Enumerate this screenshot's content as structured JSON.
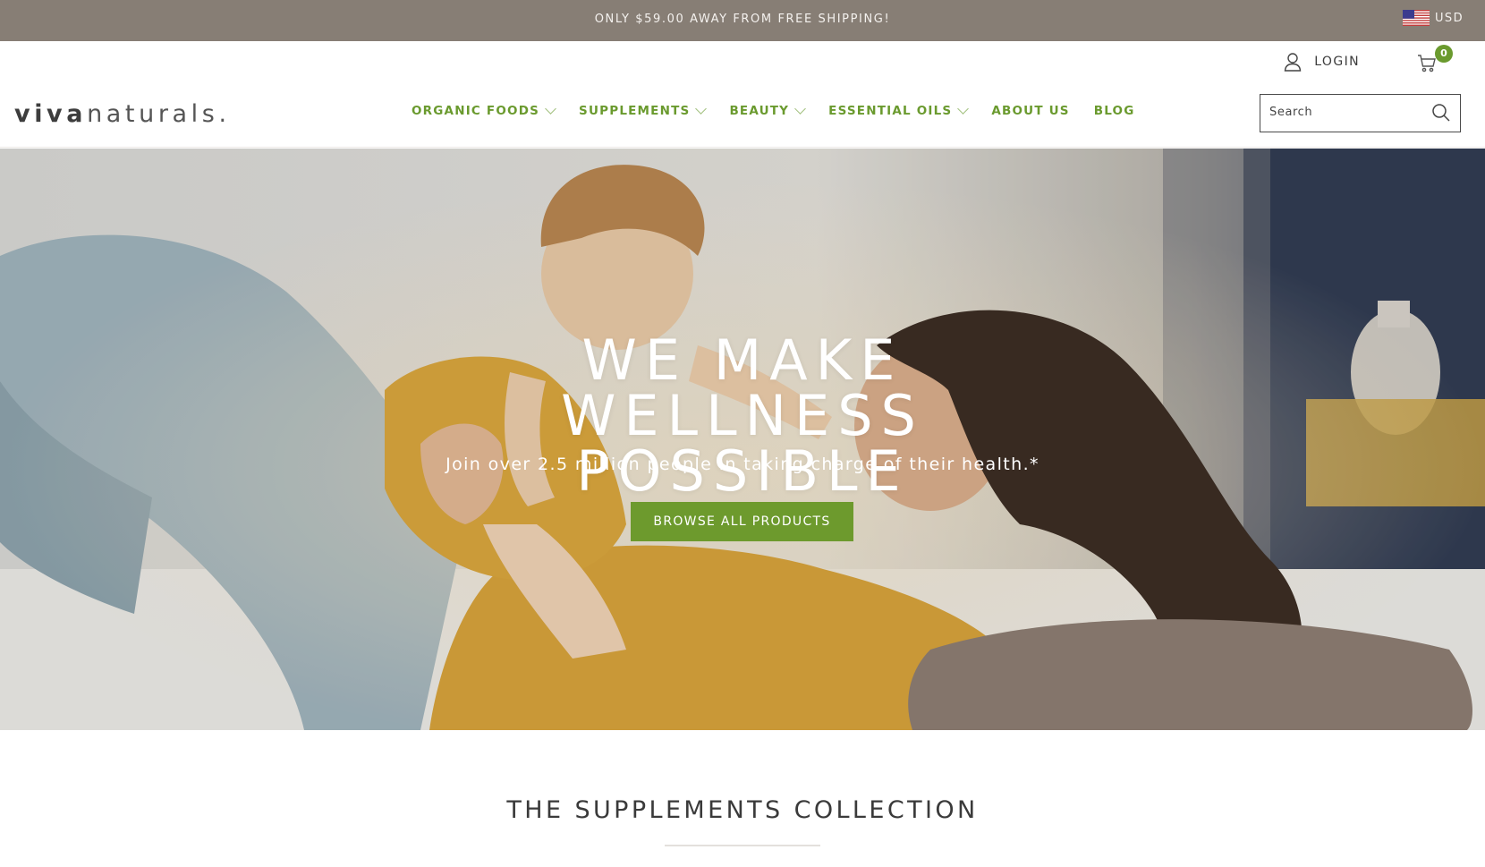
{
  "announcement": {
    "text": "ONLY $59.00 AWAY FROM FREE SHIPPING!"
  },
  "currency": {
    "label": "USD",
    "flag_icon": "us-flag-icon"
  },
  "header": {
    "logo": {
      "bold": "viva",
      "light": "naturals."
    },
    "login_label": "LOGIN",
    "cart_count": "0",
    "nav": [
      {
        "label": "ORGANIC FOODS",
        "has_dropdown": true
      },
      {
        "label": "SUPPLEMENTS",
        "has_dropdown": true
      },
      {
        "label": "BEAUTY",
        "has_dropdown": true
      },
      {
        "label": "ESSENTIAL OILS",
        "has_dropdown": true
      },
      {
        "label": "ABOUT US",
        "has_dropdown": false
      },
      {
        "label": "BLOG",
        "has_dropdown": false
      }
    ],
    "search": {
      "placeholder": "Search",
      "value": ""
    }
  },
  "hero": {
    "title": "WE MAKE WELLNESS POSSIBLE",
    "subtitle": "Join over 2.5 million people in taking charge of their health.*",
    "cta_label": "BROWSE ALL PRODUCTS"
  },
  "collection": {
    "title": "THE SUPPLEMENTS COLLECTION"
  },
  "colors": {
    "announcement_bg": "#877e75",
    "brand_green": "#6a9a2e",
    "button_green": "#6d9a2d",
    "text_dark": "#3a3a3a"
  }
}
